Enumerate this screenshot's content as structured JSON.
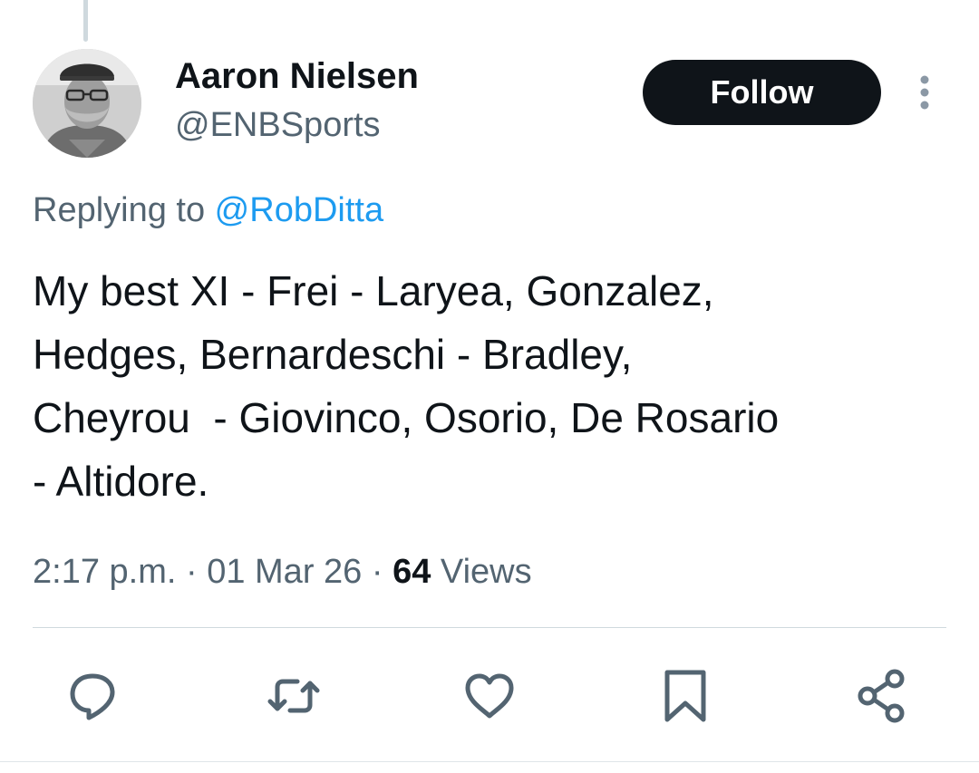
{
  "tweet": {
    "author": {
      "name": "Aaron Nielsen",
      "handle": "@ENBSports",
      "avatar_icon": "profile-photo"
    },
    "follow_label": "Follow",
    "more_icon": "more-vertical-icon",
    "reply_context": {
      "prefix": "Replying to ",
      "mention": "@RobDitta"
    },
    "text": "My best XI - Frei - Laryea, Gonzalez,\nHedges, Bernardeschi - Bradley,\nCheyrou  - Giovinco, Osorio, De Rosario\n- Altidore.",
    "meta": {
      "time": "2:17 p.m.",
      "separator": "·",
      "date": "01 Mar 26",
      "views_count": "64",
      "views_label": "Views"
    },
    "actions": [
      {
        "icon": "reply-icon"
      },
      {
        "icon": "retweet-icon"
      },
      {
        "icon": "like-icon"
      },
      {
        "icon": "bookmark-icon"
      },
      {
        "icon": "share-icon"
      }
    ]
  },
  "colors": {
    "text_primary": "#0f1419",
    "text_secondary": "#536471",
    "link": "#1d9bf0",
    "follow_bg": "#0f1419",
    "divider": "#cfd9de"
  }
}
